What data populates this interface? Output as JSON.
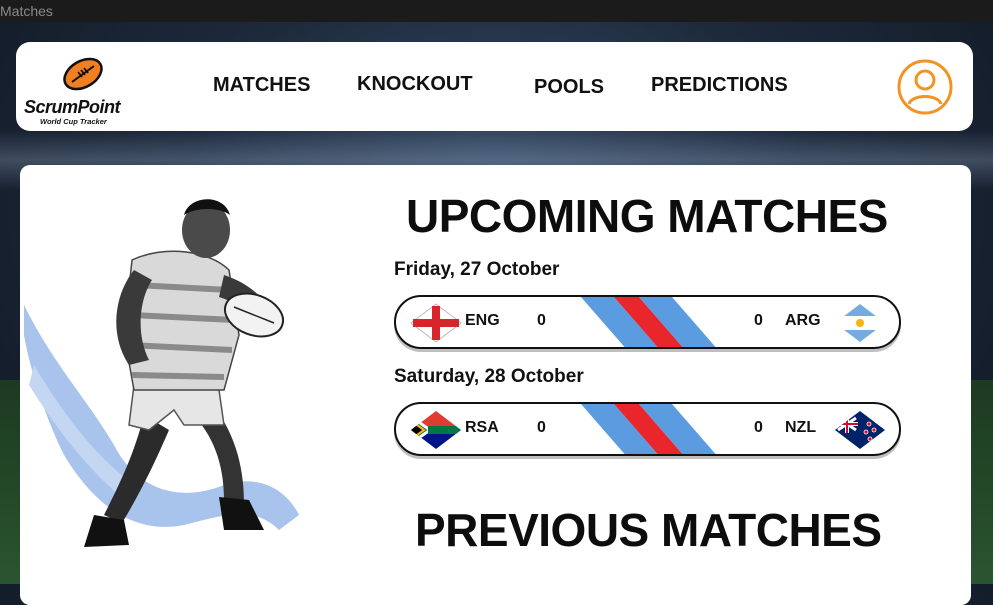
{
  "window": {
    "title": "Matches"
  },
  "brand": {
    "name": "ScrumPoint",
    "tagline": "World Cup Tracker"
  },
  "nav": {
    "items": [
      {
        "label": "MATCHES"
      },
      {
        "label": "KNOCKOUT"
      },
      {
        "label": "POOLS"
      },
      {
        "label": "PREDICTIONS"
      }
    ]
  },
  "colors": {
    "accent": "#F39323",
    "stripe_blue": "#5B9BE0",
    "stripe_red": "#E8262B"
  },
  "upcoming": {
    "title": "UPCOMING MATCHES",
    "matches": [
      {
        "date": "Friday, 27 October",
        "home": "ENG",
        "home_score": "0",
        "away": "ARG",
        "away_score": "0",
        "home_flag": "england-flag-icon",
        "away_flag": "argentina-flag-icon"
      },
      {
        "date": "Saturday, 28 October",
        "home": "RSA",
        "home_score": "0",
        "away": "NZL",
        "away_score": "0",
        "home_flag": "south-africa-flag-icon",
        "away_flag": "new-zealand-flag-icon"
      }
    ]
  },
  "previous": {
    "title": "PREVIOUS MATCHES"
  }
}
